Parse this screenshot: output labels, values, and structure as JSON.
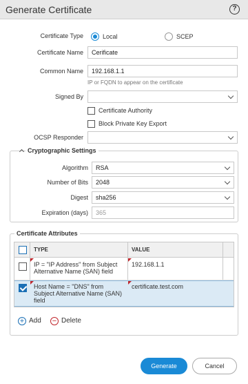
{
  "dialog": {
    "title": "Generate Certificate",
    "help_icon": "?"
  },
  "form": {
    "certificate_type": {
      "label": "Certificate Type",
      "options": [
        "Local",
        "SCEP"
      ],
      "selected": "Local"
    },
    "certificate_name": {
      "label": "Certificate Name",
      "value": "Cerificate"
    },
    "common_name": {
      "label": "Common Name",
      "value": "192.168.1.1",
      "hint": "IP or FQDN to appear on the certificate"
    },
    "signed_by": {
      "label": "Signed By",
      "value": ""
    },
    "certificate_authority": {
      "label": "Certificate Authority",
      "checked": false
    },
    "block_private_key_export": {
      "label": "Block Private Key Export",
      "checked": false
    },
    "ocsp_responder": {
      "label": "OCSP Responder",
      "value": ""
    }
  },
  "crypto": {
    "title": "Cryptographic Settings",
    "algorithm": {
      "label": "Algorithm",
      "value": "RSA"
    },
    "number_of_bits": {
      "label": "Number of Bits",
      "value": "2048"
    },
    "digest": {
      "label": "Digest",
      "value": "sha256"
    },
    "expiration": {
      "label": "Expiration (days)",
      "value": "365"
    }
  },
  "attributes": {
    "title": "Certificate Attributes",
    "columns": [
      "TYPE",
      "VALUE"
    ],
    "rows": [
      {
        "type": "IP = \"IP Address\" from Subject Alternative Name (SAN) field",
        "value": "192.168.1.1",
        "checked": false
      },
      {
        "type": "Host Name = \"DNS\" from Subject Alternative Name (SAN) field",
        "value": "certificate.test.com",
        "checked": true
      }
    ],
    "add_label": "Add",
    "delete_label": "Delete"
  },
  "buttons": {
    "generate": "Generate",
    "cancel": "Cancel"
  },
  "colors": {
    "accent": "#1a8ad6",
    "delete": "#c0252b",
    "selected_row": "#dbeaf5"
  }
}
